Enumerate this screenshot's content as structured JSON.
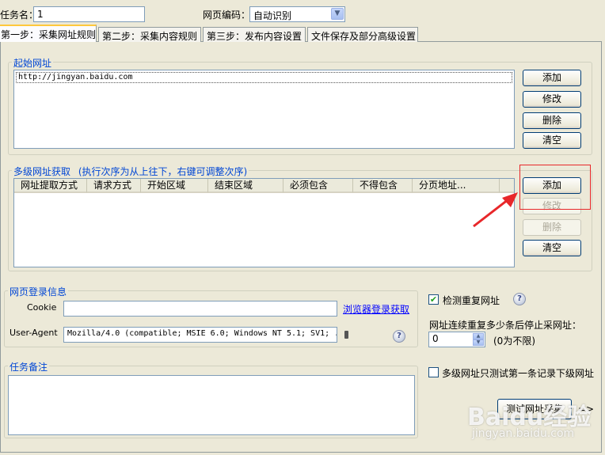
{
  "header": {
    "task_name_label": "任务名：",
    "task_name_value": "1",
    "encoding_label": "网页编码：",
    "encoding_value": "自动识别"
  },
  "tabs": [
    {
      "label": "第一步：采集网址规则",
      "active": true
    },
    {
      "label": "第二步：采集内容规则",
      "active": false
    },
    {
      "label": "第三步：发布内容设置",
      "active": false
    },
    {
      "label": "文件保存及部分高级设置",
      "active": false
    }
  ],
  "start_url": {
    "title": "起始网址",
    "items": [
      "http://jingyan.baidu.com"
    ],
    "buttons": {
      "add": "添加",
      "edit": "修改",
      "delete": "删除",
      "clear": "清空"
    }
  },
  "multi_level": {
    "title": "多级网址获取",
    "hint": "(执行次序为从上往下，右键可调整次序)",
    "columns": [
      "网址提取方式",
      "请求方式",
      "开始区域",
      "结束区域",
      "必须包含",
      "不得包含",
      "分页地址..."
    ],
    "buttons": {
      "add": "添加",
      "edit": "修改",
      "delete": "删除",
      "clear": "清空"
    }
  },
  "login": {
    "title": "网页登录信息",
    "cookie_label": "Cookie",
    "cookie_value": "",
    "browser_login_link": "浏览器登录获取",
    "useragent_label": "User-Agent",
    "useragent_value": "Mozilla/4.0 (compatible; MSIE 6.0; Windows NT 5.1; SV1; ."
  },
  "options": {
    "detect_duplicate_label": "检测重复网址",
    "detect_duplicate_checked": true,
    "stop_after_label": "网址连续重复多少条后停止采网址：",
    "stop_after_value": "0",
    "stop_after_hint": "(0为不限)",
    "multi_first_only_label": "多级网址只测试第一条记录下级网址",
    "multi_first_only_checked": false
  },
  "notes": {
    "title": "任务备注",
    "value": ""
  },
  "footer": {
    "test_button": "测试网址采集",
    "arrow": "=>"
  },
  "watermark": {
    "brand": "Baidu经验",
    "url": "jingyan.baidu.com"
  },
  "colors": {
    "annotation_red": "#e8272a",
    "group_title_blue": "#0046d5",
    "link_blue": "#0000ff"
  }
}
